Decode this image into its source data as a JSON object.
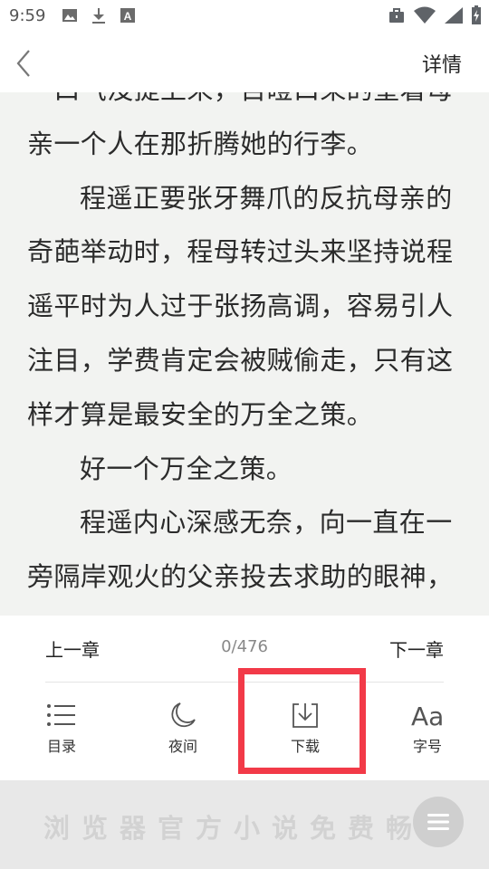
{
  "status_bar": {
    "time": "9:59",
    "left_icons": [
      "image-icon",
      "download-icon",
      "a-badge-icon"
    ],
    "right_icons": [
      "briefcase-icon",
      "wifi-icon",
      "signal-icon",
      "battery-icon"
    ]
  },
  "top_bar": {
    "detail_label": "详情"
  },
  "reader": {
    "paragraphs": [
      {
        "text": "一口气没提上来，目瞪口呆的望着母亲一个人在那折腾她的行李。",
        "indent": false
      },
      {
        "text": "程遥正要张牙舞爪的反抗母亲的奇葩举动时，程母转过头来坚持说程遥平时为人过于张扬高调，容易引人注目，学费肯定会被贼偷走，只有这样才算是最安全的万全之策。",
        "indent": true
      },
      {
        "text": "好一个万全之策。",
        "indent": true
      },
      {
        "text": "程遥内心深感无奈，向一直在一旁隔岸观火的父亲投去求助的眼神，",
        "indent": true
      }
    ]
  },
  "chapter_nav": {
    "prev_label": "上一章",
    "page_indicator": "0/476",
    "next_label": "下一章"
  },
  "toolbar": {
    "toc_label": "目录",
    "night_label": "夜间",
    "download_label": "下载",
    "font_label": "字号",
    "font_icon_text": "Aa"
  },
  "ad": {
    "text": "浏览器官方小说免费畅读"
  },
  "colors": {
    "highlight": "#f23a48",
    "reader_bg": "#f2f3f1"
  }
}
